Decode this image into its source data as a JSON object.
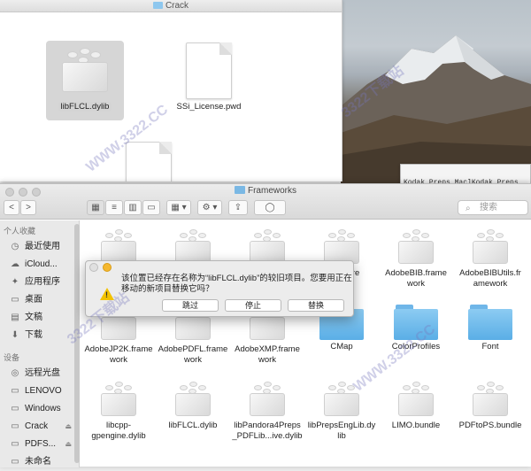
{
  "crack_window": {
    "title": "Crack",
    "files": [
      {
        "name": "libFLCL.dylib",
        "kind": "dylib",
        "selected": true
      },
      {
        "name": "SSi_License.pwd",
        "kind": "document",
        "selected": false
      },
      {
        "name": "",
        "kind": "document",
        "selected": false
      }
    ]
  },
  "kodak_window": {
    "title": "Kodak Preps Mac]Kodak Preps"
  },
  "frameworks_window": {
    "title": "Frameworks",
    "toolbar": {
      "back": "<",
      "forward": ">",
      "view_icon": "▦",
      "view_list": "≡",
      "view_columns": "▥",
      "view_coverflow": "▭",
      "arrange": "▦ ▾",
      "action": "⚙ ▾",
      "share": "⇪",
      "tags": "◯",
      "search_placeholder": "搜索",
      "search_icon": "⌕"
    },
    "sidebar": {
      "favorites_header": "个人收藏",
      "favorites": [
        {
          "label": "最近使用",
          "icon": "clock-icon",
          "glyph": "◷"
        },
        {
          "label": "iCloud...",
          "icon": "cloud-icon",
          "glyph": "☁"
        },
        {
          "label": "应用程序",
          "icon": "apps-icon",
          "glyph": "✦"
        },
        {
          "label": "桌面",
          "icon": "desktop-icon",
          "glyph": "▭"
        },
        {
          "label": "文稿",
          "icon": "documents-icon",
          "glyph": "▤"
        },
        {
          "label": "下载",
          "icon": "download-icon",
          "glyph": "⬇"
        }
      ],
      "devices_header": "设备",
      "devices": [
        {
          "label": "远程光盘",
          "icon": "disc-icon",
          "glyph": "◎",
          "eject": false
        },
        {
          "label": "LENOVO",
          "icon": "computer-icon",
          "glyph": "▭",
          "eject": false
        },
        {
          "label": "Windows",
          "icon": "drive-icon",
          "glyph": "▭",
          "eject": false
        },
        {
          "label": "Crack",
          "icon": "drive-icon",
          "glyph": "▭",
          "eject": true
        },
        {
          "label": "PDFS...",
          "icon": "drive-icon",
          "glyph": "▭",
          "eject": true
        },
        {
          "label": "未命名",
          "icon": "drive-icon",
          "glyph": "▭",
          "eject": false
        }
      ],
      "eject_glyph": "⏏"
    },
    "items": [
      {
        "name": "",
        "kind": "dylib"
      },
      {
        "name": "",
        "kind": "dylib"
      },
      {
        "name": "",
        "kind": "dylib"
      },
      {
        "name": "BIBShare\nework",
        "kind": "dylib"
      },
      {
        "name": "AdobeBIB.frame\nwork",
        "kind": "dylib"
      },
      {
        "name": "AdobeBIBUtils.fr\namework",
        "kind": "dylib"
      },
      {
        "name": "AdobeJP2K.frame\nwork",
        "kind": "dylib"
      },
      {
        "name": "AdobePDFL.frame\nwork",
        "kind": "dylib"
      },
      {
        "name": "AdobeXMP.frame\nwork",
        "kind": "dylib"
      },
      {
        "name": "CMap",
        "kind": "folder"
      },
      {
        "name": "ColorProfiles",
        "kind": "folder"
      },
      {
        "name": "Font",
        "kind": "folder"
      },
      {
        "name": "libcpp-\ngpengine.dylib",
        "kind": "dylib"
      },
      {
        "name": "libFLCL.dylib",
        "kind": "dylib"
      },
      {
        "name": "libPandora4Preps\n_PDFLib...ive.dylib",
        "kind": "dylib"
      },
      {
        "name": "libPrepsEngLib.dy\nlib",
        "kind": "dylib"
      },
      {
        "name": "LIMO.bundle",
        "kind": "dylib"
      },
      {
        "name": "PDFtoPS.bundle",
        "kind": "dylib"
      }
    ]
  },
  "dialog": {
    "message": "该位置已经存在名称为“libFLCL.dylib”的较旧项目。您要用正在移动的新项目替换它吗？",
    "warning_glyph": "!",
    "buttons": {
      "skip": "跳过",
      "stop": "停止",
      "replace": "替换"
    }
  },
  "watermarks": [
    "WWW.3322.CC",
    "3322下载站",
    "WWW.3322.CC",
    "3322下载站"
  ],
  "colors": {
    "folder": "#5aaee6",
    "close": "#e6e6e6",
    "minimize": "#f5b82f"
  }
}
